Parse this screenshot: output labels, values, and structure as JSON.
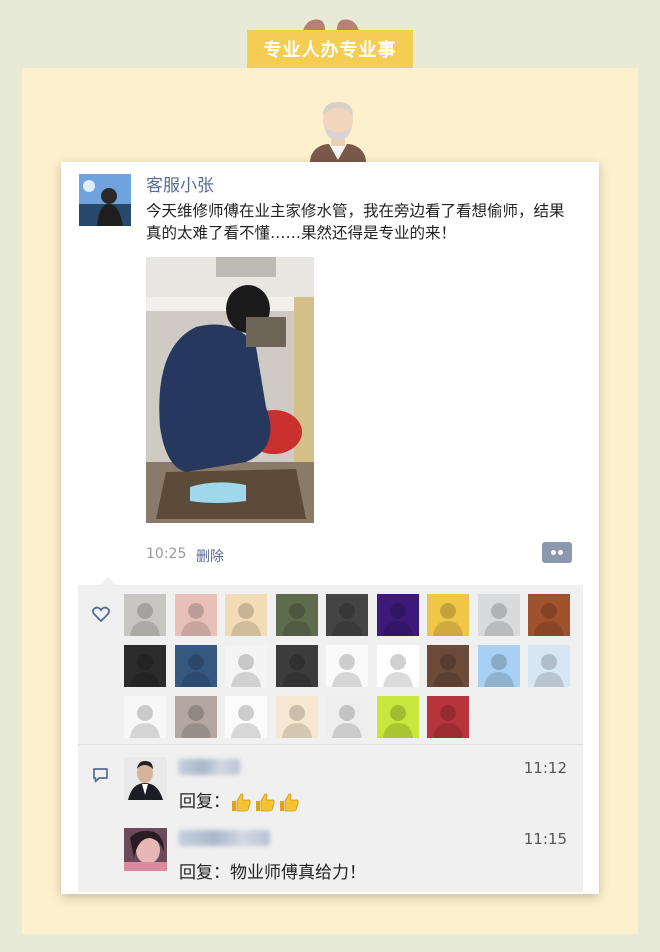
{
  "banner": {
    "title": "专业人办专业事"
  },
  "post": {
    "name": "客服小张",
    "text": "今天维修师傅在业主家修水管，我在旁边看了看想偷师，结果真的太难了看不懂……果然还得是专业的来！",
    "time": "10:25",
    "delete_label": "删除",
    "more_icon": "more-dots-icon"
  },
  "likes": {
    "icon": "heart-icon",
    "avatar_colors": [
      "#c8c6c3",
      "#e8c0b8",
      "#f2dcb6",
      "#5e6b4d",
      "#444444",
      "#3d1a7a",
      "#f1c548",
      "#d8dadc",
      "#a0522d",
      "#2b2b2b",
      "#355880",
      "#f4f4f4",
      "#3c3c3c",
      "#fafafa",
      "#ffffff",
      "#6b4a3a",
      "#a8d0f2",
      "#d7e6f3",
      "#f7f7f7",
      "#b3a7a0",
      "#fbfbfb",
      "#f6e8d0",
      "#eeeeee",
      "#c8e63b",
      "#b8343c"
    ]
  },
  "comments": {
    "icon": "comment-icon",
    "items": [
      {
        "time": "11:12",
        "prefix": "回复：",
        "text": ""
      },
      {
        "time": "11:15",
        "prefix": "回复：",
        "text": "物业师傅真给力！"
      }
    ]
  },
  "colors": {
    "banner": "#f5cd52",
    "panel": "#fdf0cc",
    "page": "#e6ead6",
    "link": "#576b95"
  }
}
